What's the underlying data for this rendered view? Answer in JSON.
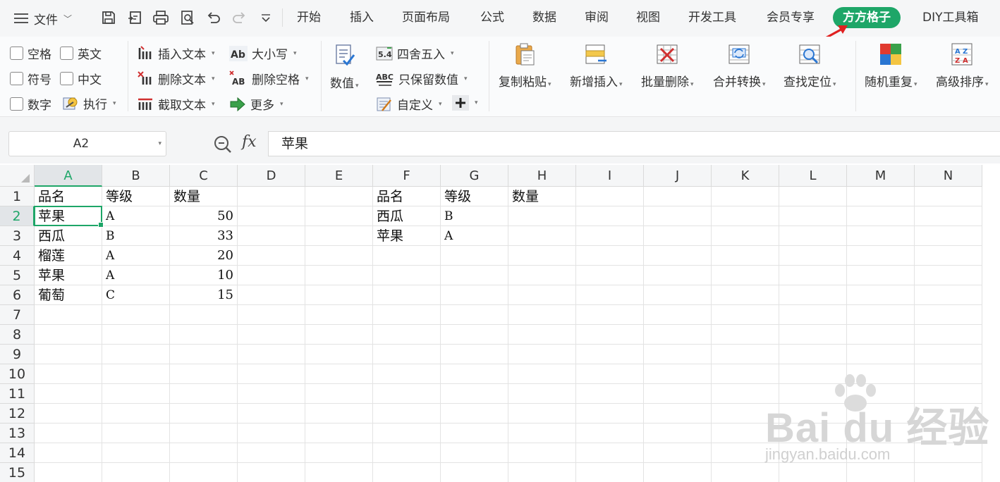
{
  "menubar": {
    "file_label": "文件",
    "tabs": [
      "开始",
      "插入",
      "页面布局",
      "公式",
      "数据",
      "审阅",
      "视图",
      "开发工具",
      "会员专享",
      "方方格子",
      "DIY工具箱"
    ],
    "active_tab": "方方格子",
    "accent_color": "#1ea668"
  },
  "ribbon": {
    "checkboxes": [
      "空格",
      "英文",
      "符号",
      "中文",
      "数字"
    ],
    "execute": "执行",
    "insert_text": "插入文本",
    "delete_text": "删除文本",
    "cut_text": "截取文本",
    "case": "大小写",
    "remove_spaces": "删除空格",
    "more": "更多",
    "numeric": "数值",
    "round": "四舍五入",
    "keep_numeric": "只保留数值",
    "custom": "自定义",
    "copy_paste": "复制粘贴",
    "insert_new": "新增插入",
    "batch_delete": "批量删除",
    "merge_convert": "合并转换",
    "find_locate": "查找定位",
    "random_repeat": "随机重复",
    "advanced_sort": "高级排序"
  },
  "formula_bar": {
    "name_box": "A2",
    "fx_label": "fx",
    "content": "苹果"
  },
  "sheet": {
    "columns": [
      "A",
      "B",
      "C",
      "D",
      "E",
      "F",
      "G",
      "H",
      "I",
      "J",
      "K",
      "L",
      "M",
      "N"
    ],
    "rows": [
      "1",
      "2",
      "3",
      "4",
      "5",
      "6",
      "7",
      "8",
      "9",
      "10",
      "11",
      "12",
      "13",
      "14",
      "15"
    ],
    "selected_cell": "A2",
    "cells": {
      "A1": "品名",
      "B1": "等级",
      "C1": "数量",
      "A2": "苹果",
      "B2": "A",
      "C2": "50",
      "A3": "西瓜",
      "B3": "B",
      "C3": "33",
      "A4": "榴莲",
      "B4": "A",
      "C4": "20",
      "A5": "苹果",
      "B5": "A",
      "C5": "10",
      "A6": "葡萄",
      "B6": "C",
      "C6": "15",
      "F1": "品名",
      "G1": "等级",
      "H1": "数量",
      "F2": "西瓜",
      "G2": "B",
      "F3": "苹果",
      "G3": "A"
    }
  },
  "watermark": {
    "brand": "Bai du 经验",
    "url": "jingyan.baidu.com"
  }
}
